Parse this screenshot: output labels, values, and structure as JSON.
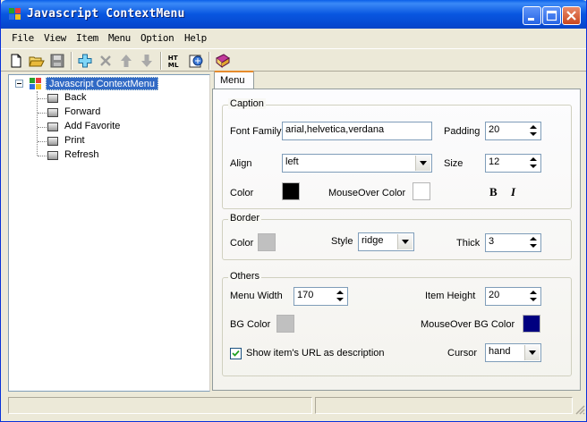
{
  "window": {
    "title": "Javascript ContextMenu"
  },
  "menubar": {
    "items": [
      "File",
      "View",
      "Item",
      "Menu",
      "Option",
      "Help"
    ]
  },
  "toolbar": {
    "icons": [
      "new-file-icon",
      "open-folder-icon",
      "save-icon",
      "add-item-icon",
      "delete-item-icon",
      "move-up-icon",
      "move-down-icon",
      "html-export-icon",
      "preview-icon",
      "help-book-icon"
    ],
    "html_label_top": "HT",
    "html_label_bottom": "ML"
  },
  "tree": {
    "root_label": "Javascript ContextMenu",
    "items": [
      "Back",
      "Forward",
      "Add Favorite",
      "Print",
      "Refresh"
    ]
  },
  "tabs": {
    "active": "Menu"
  },
  "caption": {
    "title": "Caption",
    "font_family_label": "Font Family",
    "font_family_value": "arial,helvetica,verdana",
    "padding_label": "Padding",
    "padding_value": "20",
    "align_label": "Align",
    "align_value": "left",
    "size_label": "Size",
    "size_value": "12",
    "color_label": "Color",
    "color_value": "#000000",
    "mouseover_color_label": "MouseOver Color",
    "mouseover_color_value": "#ffffff",
    "bold_label": "B",
    "italic_label": "I"
  },
  "border": {
    "title": "Border",
    "color_label": "Color",
    "color_value": "#c0c0c0",
    "style_label": "Style",
    "style_value": "ridge",
    "thick_label": "Thick",
    "thick_value": "3"
  },
  "others": {
    "title": "Others",
    "menu_width_label": "Menu Width",
    "menu_width_value": "170",
    "item_height_label": "Item Height",
    "item_height_value": "20",
    "bg_color_label": "BG Color",
    "bg_color_value": "#c0c0c0",
    "mouseover_bg_color_label": "MouseOver BG Color",
    "mouseover_bg_color_value": "#000080",
    "show_url_label": "Show item's URL as description",
    "show_url_checked": true,
    "cursor_label": "Cursor",
    "cursor_value": "hand"
  }
}
